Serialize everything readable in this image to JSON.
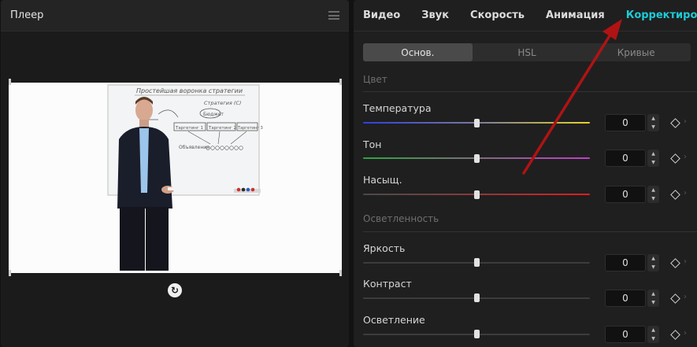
{
  "player": {
    "title": "Плеер",
    "menu_icon": "hamburger-menu-icon",
    "reset_icon": "reset-rotation-icon",
    "video_text": {
      "board_title": "Простейшая воронка стратегии",
      "board_subtitle": "Стратегия (С)",
      "box_1": "Таргетинг 1",
      "box_2": "Таргетинг 2",
      "box_3": "Таргетинг 3",
      "budget": "Бюджет",
      "bottom": "Объявления"
    }
  },
  "edit": {
    "tabs": [
      {
        "label": "Видео",
        "active": false
      },
      {
        "label": "Звук",
        "active": false
      },
      {
        "label": "Скорость",
        "active": false
      },
      {
        "label": "Анимация",
        "active": false
      },
      {
        "label": "Корректировка",
        "active": true
      }
    ],
    "subtabs": [
      {
        "label": "Основ.",
        "active": true
      },
      {
        "label": "HSL",
        "active": false
      },
      {
        "label": "Кривые",
        "active": false
      }
    ],
    "sections": [
      {
        "title": "Цвет",
        "params": [
          {
            "label": "Температура",
            "value": "0",
            "gradient": "temperature"
          },
          {
            "label": "Тон",
            "value": "0",
            "gradient": "tint"
          },
          {
            "label": "Насыщ.",
            "value": "0",
            "gradient": "saturation"
          }
        ]
      },
      {
        "title": "Осветленность",
        "params": [
          {
            "label": "Яркость",
            "value": "0",
            "gradient": "plain"
          },
          {
            "label": "Контраст",
            "value": "0",
            "gradient": "plain"
          },
          {
            "label": "Осветление",
            "value": "0",
            "gradient": "plain"
          }
        ]
      }
    ],
    "keyframe_icon": "keyframe-diamond-icon",
    "spinner_icons": [
      "chevron-up-icon",
      "chevron-down-icon"
    ]
  },
  "colors": {
    "accent": "#1ecbd6",
    "annotation_arrow": "#b01313"
  }
}
